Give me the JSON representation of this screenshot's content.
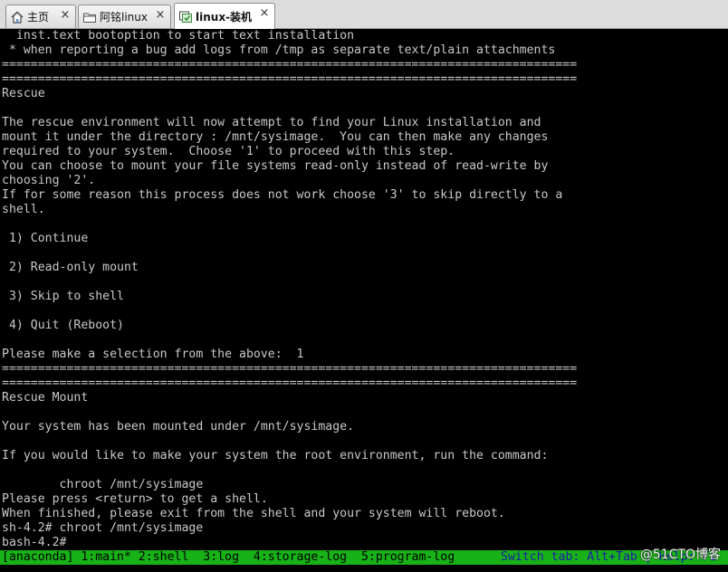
{
  "tabs": [
    {
      "label": "主页",
      "icon": "home-icon",
      "active": false
    },
    {
      "label": "阿铭linux",
      "icon": "folder-icon",
      "active": false
    },
    {
      "label": "linux-装机",
      "icon": "vm-icon",
      "active": true
    }
  ],
  "close_glyph": "×",
  "terminal": {
    "lines": [
      "  inst.text bootoption to start text installation",
      " * when reporting a bug add logs from /tmp as separate text/plain attachments",
      "================================================================================",
      "================================================================================",
      "Rescue",
      "",
      "The rescue environment will now attempt to find your Linux installation and",
      "mount it under the directory : /mnt/sysimage.  You can then make any changes",
      "required to your system.  Choose '1' to proceed with this step.",
      "You can choose to mount your file systems read-only instead of read-write by",
      "choosing '2'.",
      "If for some reason this process does not work choose '3' to skip directly to a",
      "shell.",
      "",
      " 1) Continue",
      "",
      " 2) Read-only mount",
      "",
      " 3) Skip to shell",
      "",
      " 4) Quit (Reboot)",
      "",
      "Please make a selection from the above:  1",
      "================================================================================",
      "================================================================================",
      "Rescue Mount",
      "",
      "Your system has been mounted under /mnt/sysimage.",
      "",
      "If you would like to make your system the root environment, run the command:",
      "",
      "        chroot /mnt/sysimage",
      "Please press <return> to get a shell.",
      "When finished, please exit from the shell and your system will reboot.",
      "sh-4.2# chroot /mnt/sysimage",
      "bash-4.2#"
    ]
  },
  "statusbar": {
    "left": "[anaconda] 1:main* 2:shell  3:log  4:storage-log  5:program-log",
    "right": "Switch tab: Alt+Tab | Help: F1"
  },
  "watermark": "@51CTO博客",
  "colors": {
    "terminal_bg": "#000000",
    "terminal_fg": "#c8c8c8",
    "status_bg": "#18b218",
    "status_right_fg": "#1a1aa8"
  }
}
